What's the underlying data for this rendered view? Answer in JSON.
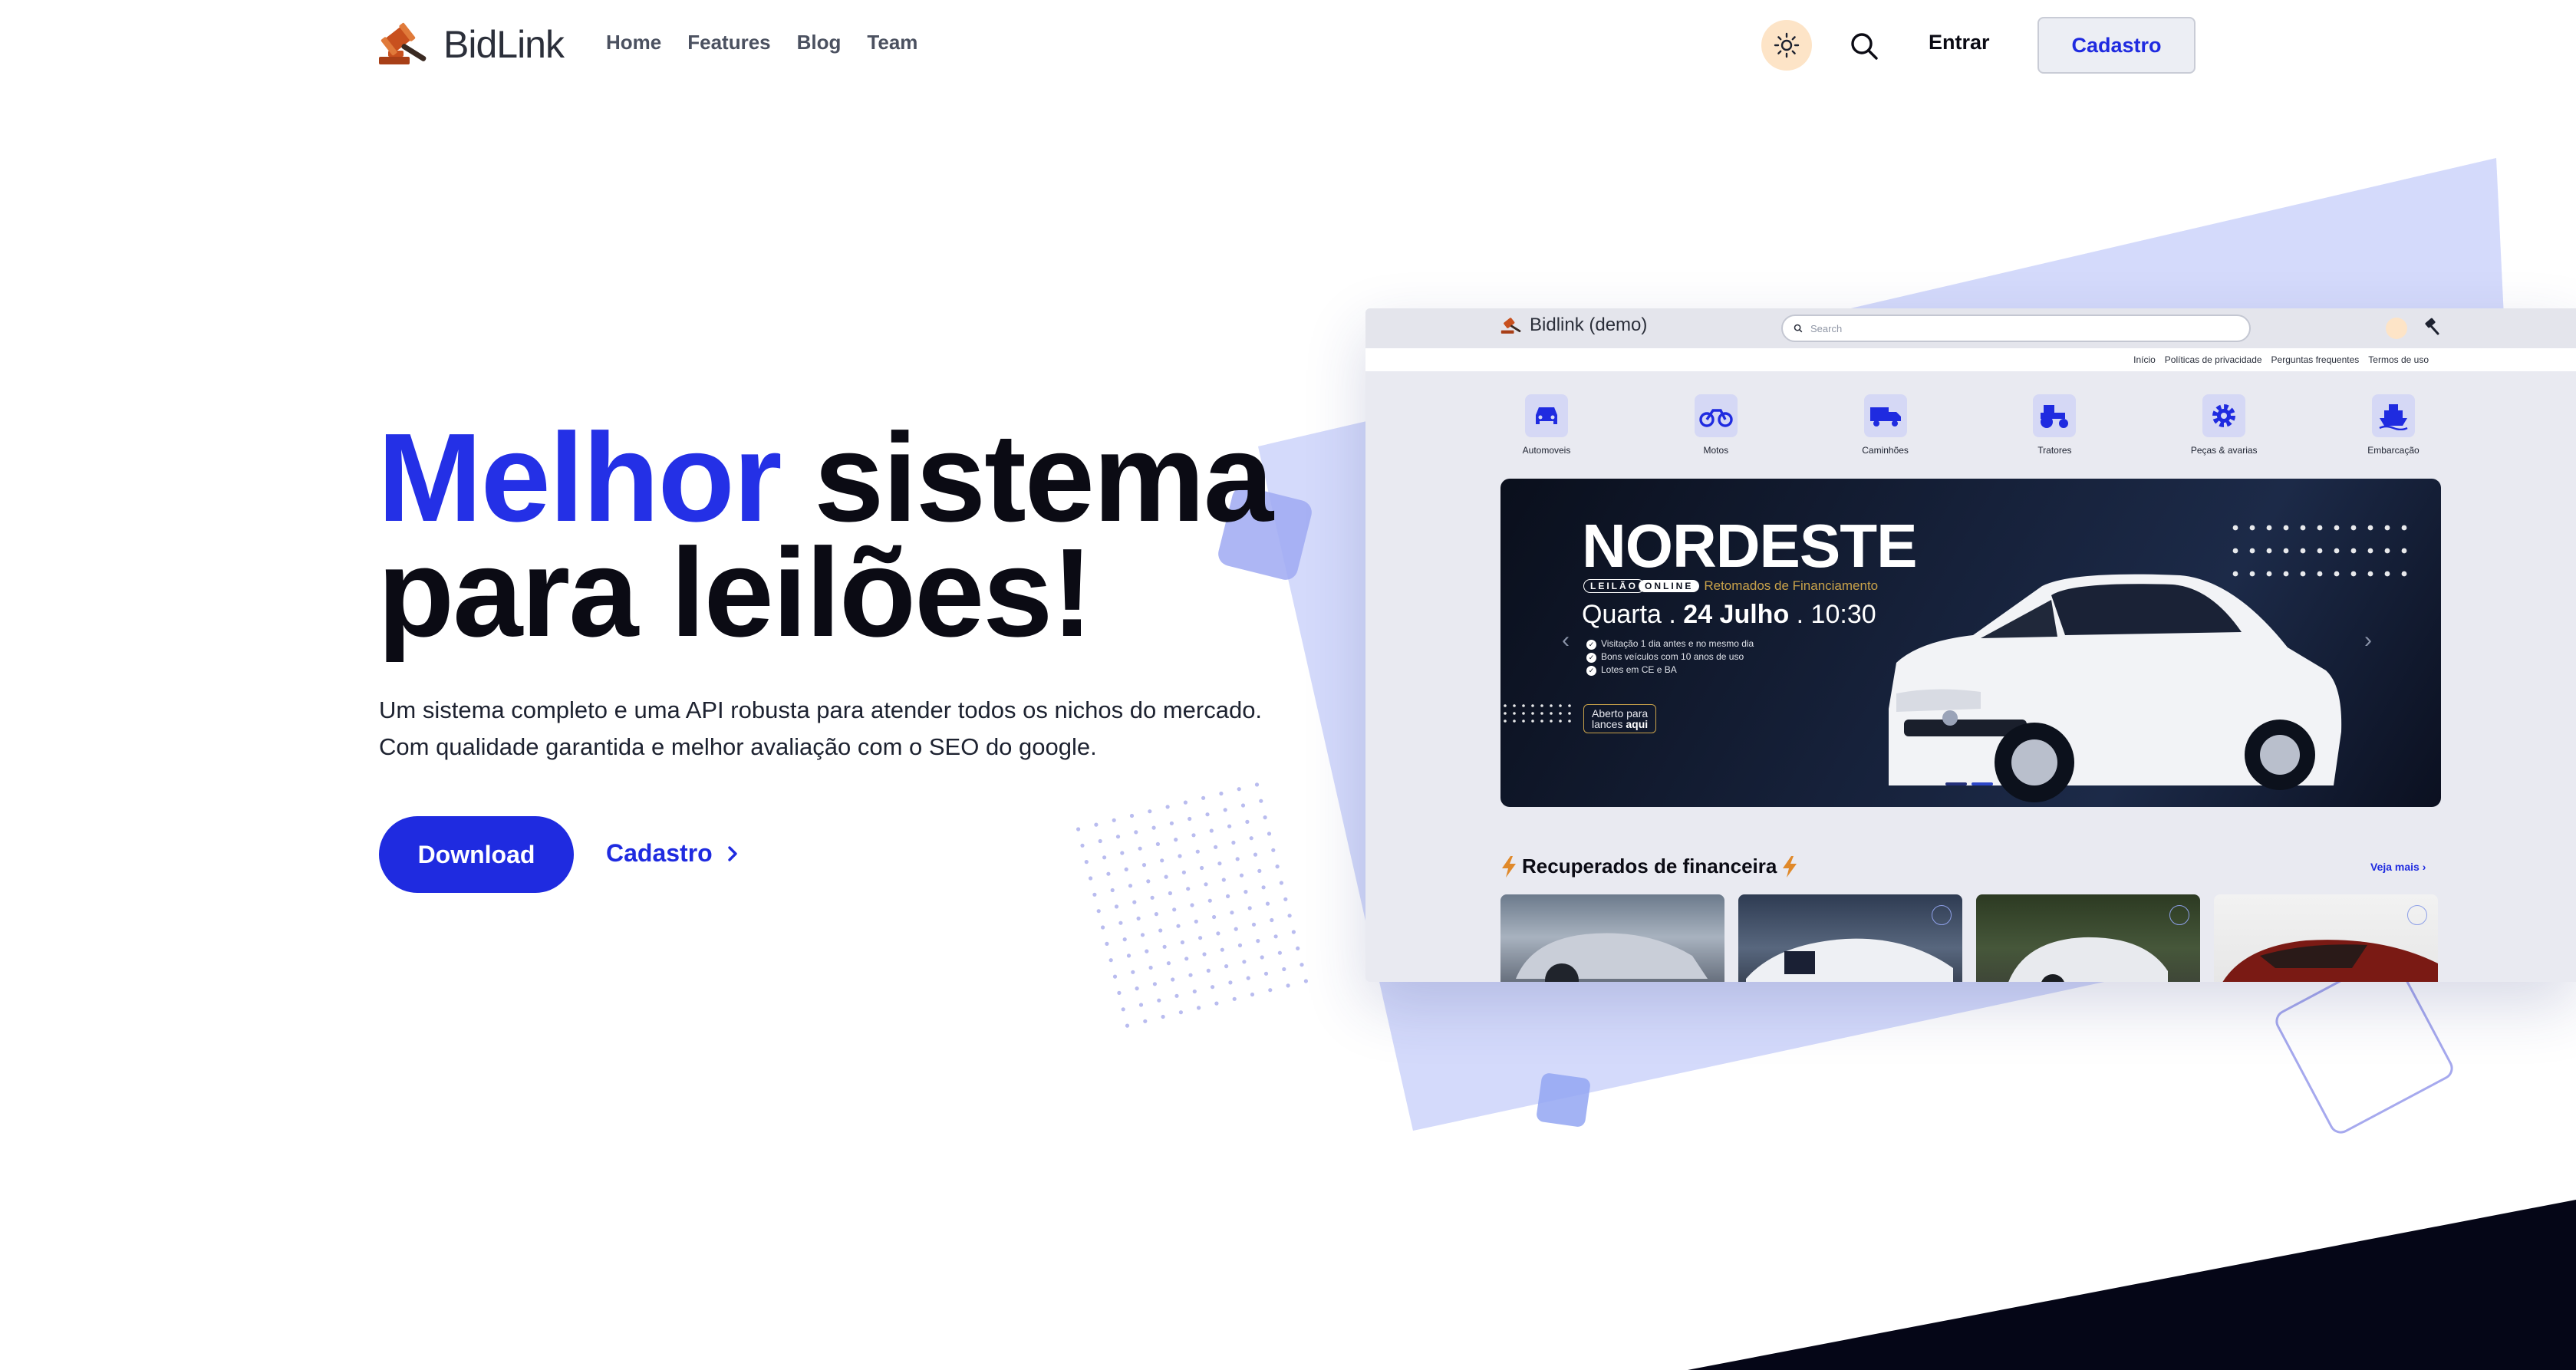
{
  "nav": {
    "brand": "BidLink",
    "links": [
      "Home",
      "Features",
      "Blog",
      "Team"
    ],
    "login_label": "Entrar",
    "signup_label": "Cadastro"
  },
  "hero": {
    "title_accent": "Melhor",
    "title_rest_1": "sistema",
    "title_rest_2": "para leilões!",
    "subtitle": "Um sistema completo e uma API robusta para atender todos os nichos do mercado. Com qualidade garantida e melhor avaliação com o SEO do google.",
    "primary_cta": "Download",
    "secondary_cta": "Cadastro"
  },
  "mockup": {
    "brand": "Bidlink (demo)",
    "search_placeholder": "Search",
    "top_links": [
      "Início",
      "Políticas de privacidade",
      "Perguntas frequentes",
      "Termos de uso"
    ],
    "categories": [
      "Automoveis",
      "Motos",
      "Caminhões",
      "Tratores",
      "Peças & avarias",
      "Embarcação"
    ],
    "banner": {
      "title": "NORDESTE",
      "tag_leilao": "LEILÃO",
      "tag_online": "ONLINE",
      "tag_sub": "Retomados de Financiamento",
      "date_day": "Quarta . ",
      "date_bold": "24 Julho",
      "date_time": " . 10:30",
      "bullets": [
        "Visitação 1 dia antes e no mesmo dia",
        "Bons veículos com 10 anos de uso",
        "Lotes em CE e BA"
      ],
      "cta_line1": "Aberto para",
      "cta_line2_a": "lances ",
      "cta_line2_b": "aqui"
    },
    "section_title": "Recuperados de financeira",
    "see_more": "Veja mais"
  },
  "colors": {
    "accent": "#1f2be0",
    "brand_orange": "#c8501e",
    "dark": "#0b0b14",
    "decor_blue": "#d6dcfa"
  }
}
